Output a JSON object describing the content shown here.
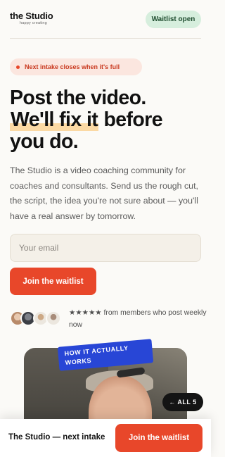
{
  "header": {
    "logo_title": "the Studio",
    "logo_tagline": "happy creating",
    "status_badge": "Waitlist open"
  },
  "notice": {
    "text": "Next intake closes when it's full"
  },
  "hero": {
    "headline_line1": "Post the video.",
    "headline_highlight": "We'll fix it",
    "headline_line2_rest": " before",
    "headline_line3": "you do.",
    "description": "The Studio is a video coaching community for coaches and consultants. Send us the rough cut, the script, the idea you're not sure about — you'll have a real answer by tomorrow."
  },
  "signup": {
    "email_placeholder": "Your email",
    "email_value": "",
    "cta_label": "Join the waitlist"
  },
  "social_proof": {
    "stars": "★★★★★",
    "text": "from members who post weekly now"
  },
  "video": {
    "tag_label": "HOW IT ACTUALLY WORKS",
    "all_button_label": "← ALL 5"
  },
  "sticky_bar": {
    "label": "The Studio — next intake",
    "cta_label": "Join the waitlist"
  },
  "colors": {
    "accent": "#e8472a",
    "badge_bg": "#d6eedd",
    "tag_blue": "#2846d6",
    "highlight": "#fbd9a4"
  }
}
